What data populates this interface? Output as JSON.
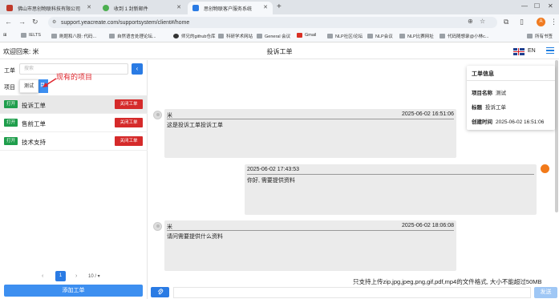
{
  "browser": {
    "tabs": [
      {
        "title": "佛山市思创物联科技有限公司",
        "fav_color": "#c03a2b",
        "active": false
      },
      {
        "title": "收到 1 封新邮件",
        "fav_color": "#4caf50",
        "active": false
      },
      {
        "title": "思创物联客户服务系统",
        "fav_color": "#2a7be4",
        "active": true
      }
    ],
    "new_tab": "+",
    "url": "support.yeacreate.com/supportsystem/client#/home",
    "profile_initial": "A",
    "bookmarks": [
      "IELTS",
      "刷题和八股: 代码...",
      "自然语言处理论坛...",
      "师兄的github仓库",
      "科研学术网站",
      "General 会议",
      "Gmail",
      "NLP社区/论坛",
      "NLP会议",
      "NLP比赛网址",
      "代码随想录@小林c...",
      "所有书签"
    ]
  },
  "header": {
    "welcome": "欢迎回来: 米",
    "title": "投诉工单",
    "lang": "EN"
  },
  "sidebar": {
    "ticket_label": "工单",
    "search_placeholder": "搜索",
    "collapse_icon": "‹",
    "project_label": "项目",
    "project_selected": "测试",
    "project_tab_suffix": "目",
    "annotation": "现有的项目",
    "items": [
      {
        "status": "打开",
        "name": "投诉工单",
        "action": "关闭工单",
        "selected": true
      },
      {
        "status": "打开",
        "name": "售前工单",
        "action": "关闭工单",
        "selected": false
      },
      {
        "status": "打开",
        "name": "技术支持",
        "action": "关闭工单",
        "selected": false
      }
    ],
    "pagination": {
      "prev": "‹",
      "current": "1",
      "next": "›",
      "page_size": "10 / ▾"
    },
    "add_button": "添加工单"
  },
  "info": {
    "title": "工单信息",
    "rows": [
      {
        "k": "项目名称",
        "v": "测试"
      },
      {
        "k": "标题",
        "v": "投诉工单"
      },
      {
        "k": "创建时间",
        "v": "2025-06-02 16:51:06"
      }
    ]
  },
  "messages": [
    {
      "side": "left",
      "sender": "米",
      "time": "2025-06-02 16:51:06",
      "text": "这是投诉工单投诉工单"
    },
    {
      "side": "right",
      "sender": "",
      "time": "2025-06-02 17:43:53",
      "text": "你好, 需要提供资料"
    },
    {
      "side": "left",
      "sender": "米",
      "time": "2025-06-02 18:06:08",
      "text": "请问需要提供什么资料"
    }
  ],
  "footer": {
    "upload_hint": "只支持上传zip,jpg,jpeg,png,gif,pdf,mp4的文件格式, 大小不能超过50MB",
    "send": "发送",
    "attach_icon": "paperclip-icon"
  }
}
